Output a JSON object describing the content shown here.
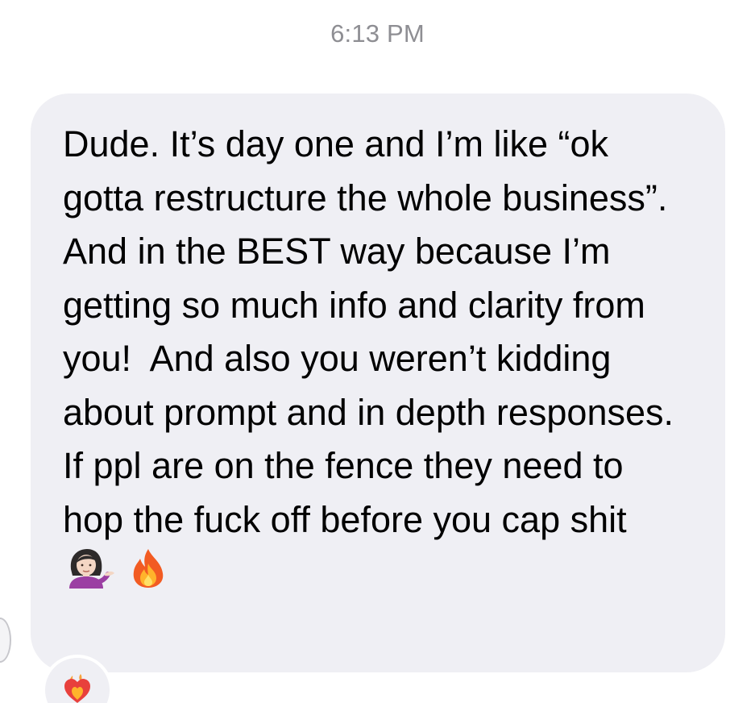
{
  "timestamp": "6:13 PM",
  "message": {
    "text_before_emoji": "Dude. It’s day one and I’m like “ok gotta restructure the whole business”. And in the BEST way because I’m getting so much info and clarity from you!  And also you weren’t kidding about prompt and in depth responses. If ppl are on the fence they need to hop the fuck off before you cap shit ",
    "emojis": [
      "person-tipping-hand-icon",
      "fire-icon"
    ],
    "bubble_color": "#efeff4",
    "text_color": "#000000"
  },
  "reaction": {
    "emoji": "heart-on-fire-icon",
    "color": "#e8403c"
  }
}
